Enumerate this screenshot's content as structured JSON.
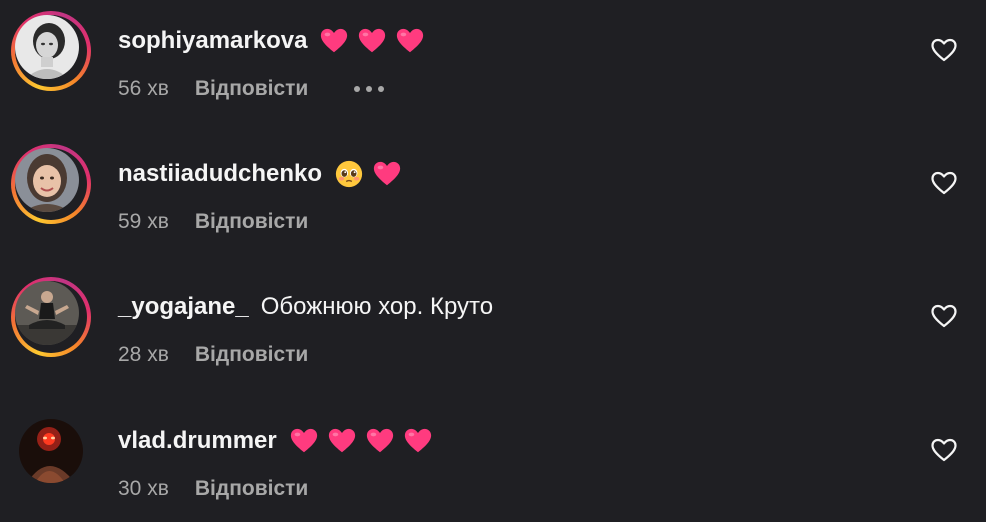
{
  "comments": [
    {
      "username": "sophiyamarkova",
      "text": "",
      "emojis": [
        "heart-emoji",
        "heart-emoji",
        "heart-emoji"
      ],
      "time": "56 хв",
      "reply_label": "Відповісти",
      "show_more": true,
      "story_ring": true,
      "avatar_icon": "portrait-woman-bw"
    },
    {
      "username": "nastiiadudchenko",
      "text": "",
      "emojis": [
        "pleading-face-emoji",
        "heart-emoji"
      ],
      "time": "59 хв",
      "reply_label": "Відповісти",
      "show_more": false,
      "story_ring": true,
      "avatar_icon": "portrait-woman-smile"
    },
    {
      "username": "_yogajane_",
      "text": "Обожнюю хор. Круто",
      "emojis": [],
      "time": "28 хв",
      "reply_label": "Відповісти",
      "show_more": false,
      "story_ring": true,
      "avatar_icon": "portrait-yoga-pose"
    },
    {
      "username": "vlad.drummer",
      "text": "",
      "emojis": [
        "heart-emoji",
        "heart-emoji",
        "heart-emoji",
        "heart-emoji"
      ],
      "time": "30 хв",
      "reply_label": "Відповісти",
      "show_more": false,
      "story_ring": false,
      "avatar_icon": "portrait-red-glow"
    }
  ],
  "colors": {
    "background": "#1f1f23",
    "heart_emoji": "#ff3b7f",
    "secondary_text": "#a8a8a8"
  }
}
